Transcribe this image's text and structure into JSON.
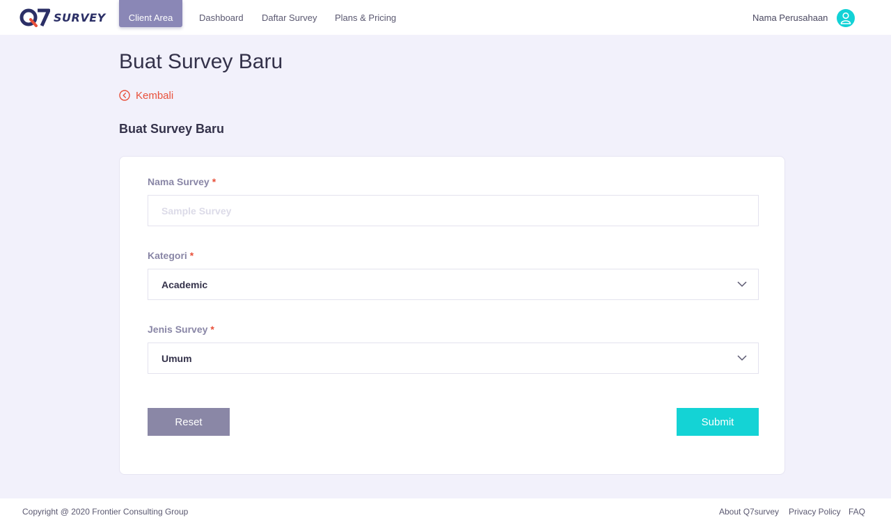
{
  "brand": {
    "logo_text": "SURVEY",
    "accent": "#12d2d6",
    "brand_color": "#2b2f66",
    "logo_red": "#e8503a"
  },
  "nav": {
    "client_area": "Client Area",
    "dashboard": "Dashboard",
    "daftar_survey": "Daftar Survey",
    "plans_pricing": "Plans & Pricing"
  },
  "user": {
    "company_name": "Nama Perusahaan",
    "avatar_icon": "user-icon"
  },
  "page": {
    "title": "Buat Survey Baru",
    "back_label": "Kembali",
    "section_title": "Buat Survey Baru"
  },
  "form": {
    "nama_survey": {
      "label": "Nama Survey",
      "required_mark": "*",
      "placeholder": "Sample Survey",
      "value": ""
    },
    "kategori": {
      "label": "Kategori",
      "required_mark": "*",
      "selected": "Academic"
    },
    "jenis_survey": {
      "label": "Jenis Survey",
      "required_mark": "*",
      "selected": "Umum"
    },
    "reset_label": "Reset",
    "submit_label": "Submit"
  },
  "footer": {
    "copyright": "Copyright @ 2020 Frontier Consulting Group",
    "links": [
      "About Q7survey",
      "Privacy Policy",
      "FAQ"
    ]
  }
}
